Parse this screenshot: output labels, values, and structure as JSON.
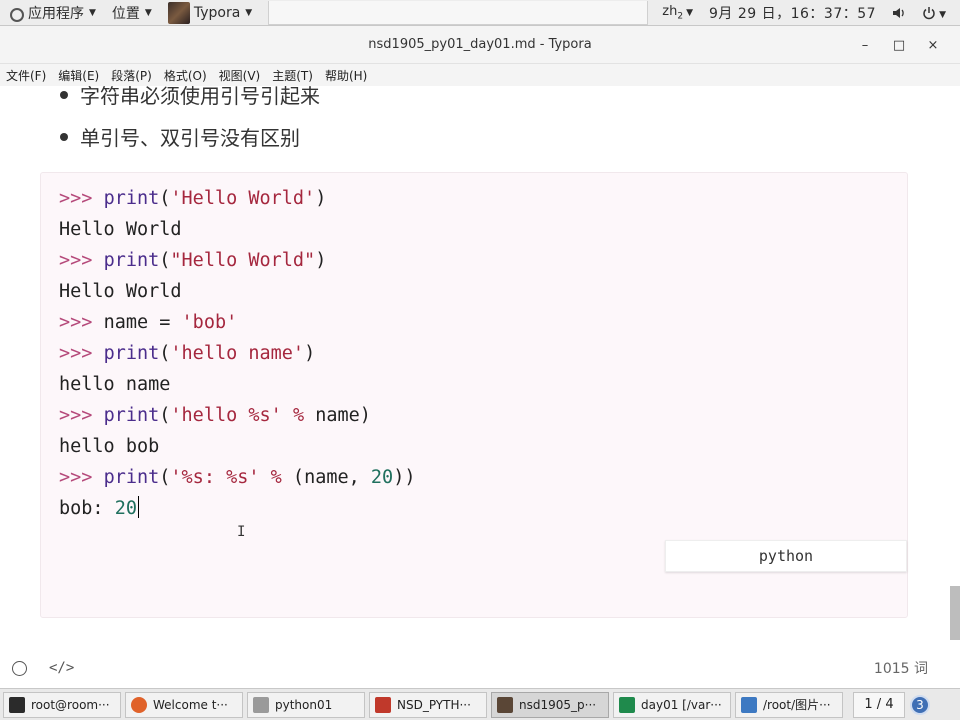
{
  "topbar": {
    "apps_label": "应用程序",
    "places_label": "位置",
    "active_app": "Typora",
    "ime": "zh",
    "clock": "9月 29 日，16：37：57"
  },
  "window": {
    "title": "nsd1905_py01_day01.md - Typora",
    "minimize": "–",
    "maximize": "□",
    "close": "×"
  },
  "menubar": [
    "文件(F)",
    "编辑(E)",
    "段落(P)",
    "格式(O)",
    "视图(V)",
    "主题(T)",
    "帮助(H)"
  ],
  "editor": {
    "bullets": [
      "字符串必须使用引号引起来",
      "单引号、双引号没有区别"
    ],
    "code_lang": "python",
    "code": {
      "prompt": ">>>",
      "print": "print",
      "l1_str": "'Hello World'",
      "l2": "Hello World",
      "l3_str": "\"Hello World\"",
      "l4": "Hello World",
      "l5_var": "name",
      "l5_eq": "=",
      "l5_str": "'bob'",
      "l6_str": "'hello name'",
      "l7": "hello name",
      "l8_str": "'hello %s'",
      "l8_op": "%",
      "l8_var": "name",
      "l9": "hello bob",
      "l10_str": "'%s: %s'",
      "l10_op": "%",
      "l10_var": "name,",
      "l10_num": "20",
      "l11_text": "bob: ",
      "l11_num": "20"
    }
  },
  "statusbar": {
    "word_count": "1015 词"
  },
  "taskbar": {
    "tasks": [
      {
        "label": "root@room···",
        "color": "#2b2b2b"
      },
      {
        "label": "Welcome t···",
        "color": "#e0622a"
      },
      {
        "label": "python01",
        "color": "#9a9a9a"
      },
      {
        "label": "NSD_PYTH···",
        "color": "#c0392b"
      },
      {
        "label": "nsd1905_p···",
        "color": "#5a4636"
      },
      {
        "label": "day01 [/var···",
        "color": "#1f8a4c"
      },
      {
        "label": "/root/图片···",
        "color": "#3d79c2"
      }
    ],
    "pager": "1 / 4",
    "workspace": "3"
  }
}
